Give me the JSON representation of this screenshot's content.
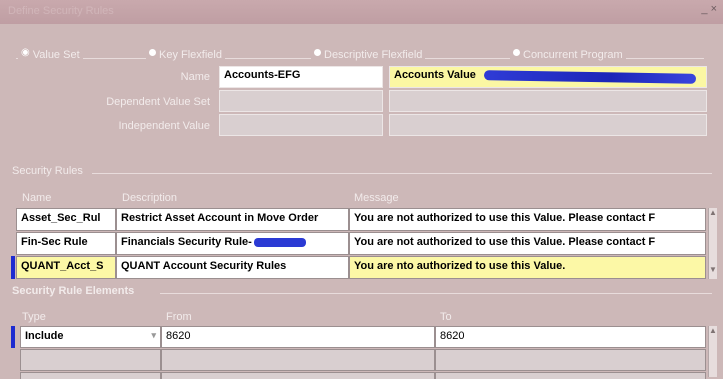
{
  "window": {
    "title": "Define Security Rules",
    "controls": "_ ×"
  },
  "radio_group": {
    "options": [
      {
        "label": "Value Set",
        "selected": true
      },
      {
        "label": "Key Flexfield",
        "selected": false
      },
      {
        "label": "Descriptive Flexfield",
        "selected": false
      },
      {
        "label": "Concurrent Program",
        "selected": false
      }
    ]
  },
  "form": {
    "name_label": "Name",
    "name_value": "Accounts-EFG",
    "name_description": "Accounts Value",
    "dependent_label": "Dependent Value Set",
    "independent_label": "Independent Value"
  },
  "security_rules": {
    "title": "Security Rules",
    "columns": {
      "name": "Name",
      "description": "Description",
      "message": "Message"
    },
    "rows": [
      {
        "name": "Asset_Sec_Rul",
        "description": "Restrict Asset Account in Move Order",
        "message": "You are not authorized to use this Value. Please contact F"
      },
      {
        "name": "Fin-Sec Rule",
        "description": "Financials Security Rule-",
        "message": "You are not authorized to use this Value. Please contact F"
      },
      {
        "name": "QUANT_Acct_S",
        "description": "QUANT Account Security Rules",
        "message": "You are nto authorized to use this Value."
      }
    ]
  },
  "rule_elements": {
    "title": "Security Rule Elements",
    "columns": {
      "type": "Type",
      "from": "From",
      "to": "To"
    },
    "rows": [
      {
        "type": "Include",
        "from": "8620",
        "to": "8620"
      }
    ]
  },
  "colors": {
    "window_bg": "#cdb8b8",
    "highlight_yellow": "#fcf8a6",
    "selection_blue": "#1d2bd0"
  }
}
